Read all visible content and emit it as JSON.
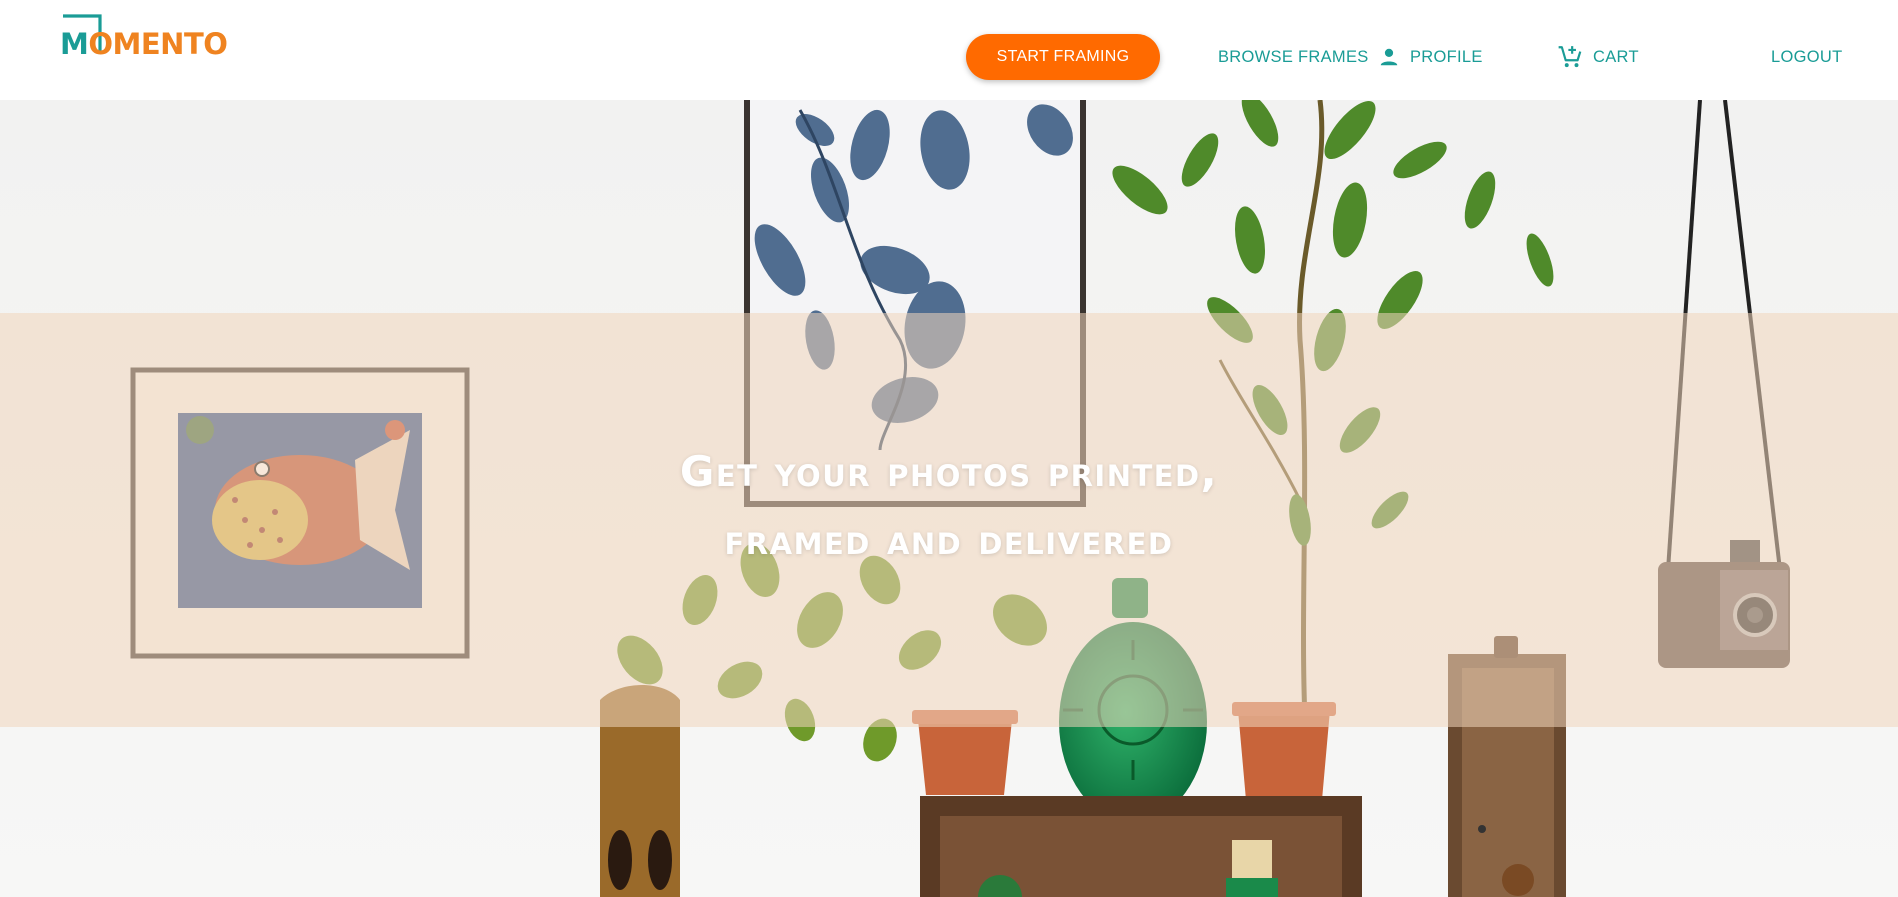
{
  "brand": {
    "logo_text": "MOMENTO",
    "logo_first_letter": "M",
    "logo_rest": "OMENTO",
    "primary_color": "#1a9c96",
    "accent_color": "#ff6a00",
    "logo_orange": "#ef8320"
  },
  "nav": {
    "start_label": "START FRAMING",
    "browse_label": "BROWSE FRAMES",
    "profile_label": "PROFILE",
    "profile_icon": "person-icon",
    "cart_label": "CART",
    "cart_icon": "add-cart-icon",
    "logout_label": "LOGOUT"
  },
  "hero": {
    "title_line1": "Get your photos printed,",
    "title_line2": "framed and delivered",
    "band_color": "#f0d6bc"
  }
}
